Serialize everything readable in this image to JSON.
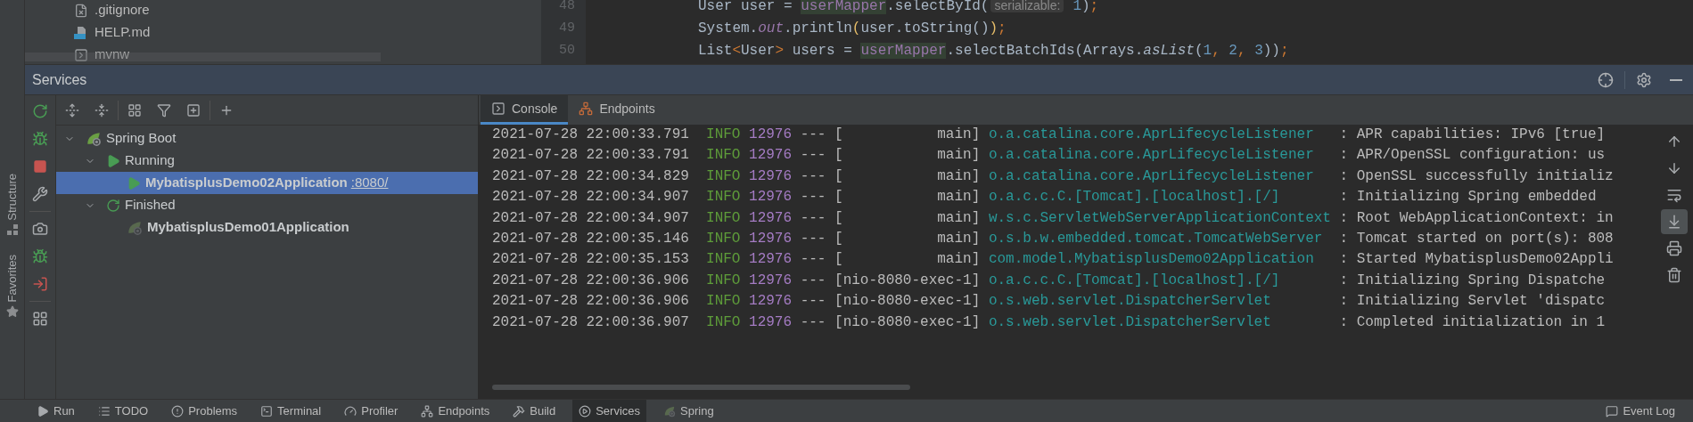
{
  "side_tabs": [
    {
      "label": "Structure",
      "kind": "structure"
    },
    {
      "label": "Favorites",
      "kind": "favorites"
    }
  ],
  "project_tree": {
    "items": [
      {
        "label": ".gitignore",
        "kind": "ignore"
      },
      {
        "label": "HELP.md",
        "kind": "markdown"
      },
      {
        "label": "mvnw",
        "kind": "script"
      }
    ]
  },
  "editor": {
    "lines": [
      {
        "number": "48",
        "segments": [
          {
            "text": "User user = ",
            "kind": "plain"
          },
          {
            "text": "userMapper",
            "kind": "member"
          },
          {
            "text": ".selectById(",
            "kind": "plain"
          },
          {
            "text": "serializable:",
            "kind": "hint"
          },
          {
            "text": "1",
            "kind": "number"
          },
          {
            "text": ")",
            "kind": "plain"
          },
          {
            "text": ";",
            "kind": "keyword"
          }
        ]
      },
      {
        "number": "49",
        "segments": [
          {
            "text": "System.",
            "kind": "plain"
          },
          {
            "text": "out",
            "kind": "static_field"
          },
          {
            "text": ".println",
            "kind": "plain"
          },
          {
            "text": "(",
            "kind": "brace"
          },
          {
            "text": "user.toString()",
            "kind": "plain"
          },
          {
            "text": ")",
            "kind": "brace"
          },
          {
            "text": ";",
            "kind": "keyword"
          }
        ]
      },
      {
        "number": "50",
        "segments": [
          {
            "text": "List",
            "kind": "plain"
          },
          {
            "text": "<",
            "kind": "keyword"
          },
          {
            "text": "User",
            "kind": "plain"
          },
          {
            "text": ">",
            "kind": "keyword"
          },
          {
            "text": " users = ",
            "kind": "plain"
          },
          {
            "text": "userMapper",
            "kind": "member"
          },
          {
            "text": ".selectBatchIds(Arrays.",
            "kind": "plain"
          },
          {
            "text": "asList",
            "kind": "static_method"
          },
          {
            "text": "(",
            "kind": "plain"
          },
          {
            "text": "1",
            "kind": "number"
          },
          {
            "text": ", ",
            "kind": "keyword"
          },
          {
            "text": "2",
            "kind": "number"
          },
          {
            "text": ", ",
            "kind": "keyword"
          },
          {
            "text": "3",
            "kind": "number"
          },
          {
            "text": "))",
            "kind": "plain"
          },
          {
            "text": ";",
            "kind": "keyword"
          }
        ]
      }
    ]
  },
  "services_panel": {
    "title": "Services",
    "tree": [
      {
        "label": "Spring Boot",
        "kind": "spring",
        "expanded": true,
        "selected": false,
        "children": [
          {
            "label": "Running",
            "kind": "running",
            "expanded": true,
            "selected": false,
            "children": [
              {
                "label": "MybatisplusDemo02Application",
                "link": ":8080/",
                "kind": "running_app",
                "selected": true
              }
            ]
          },
          {
            "label": "Finished",
            "kind": "finished",
            "expanded": true,
            "selected": false,
            "children": [
              {
                "label": "MybatisplusDemo01Application",
                "kind": "finished_app",
                "selected": false
              }
            ]
          }
        ]
      }
    ]
  },
  "console": {
    "tabs": [
      {
        "label": "Console",
        "kind": "console",
        "selected": true
      },
      {
        "label": "Endpoints",
        "kind": "endpoints",
        "selected": false
      }
    ],
    "scroll_to_end": true,
    "lines": [
      {
        "timestamp": "2021-07-28 22:00:33.791",
        "level": "INFO",
        "pid": "12976",
        "dashes": "---",
        "thread": "[           main]",
        "logger": "o.a.catalina.core.AprLifecycleListener",
        "message": ": APR capabilities: IPv6 [true]"
      },
      {
        "timestamp": "2021-07-28 22:00:33.791",
        "level": "INFO",
        "pid": "12976",
        "dashes": "---",
        "thread": "[           main]",
        "logger": "o.a.catalina.core.AprLifecycleListener",
        "message": ": APR/OpenSSL configuration: us"
      },
      {
        "timestamp": "2021-07-28 22:00:34.829",
        "level": "INFO",
        "pid": "12976",
        "dashes": "---",
        "thread": "[           main]",
        "logger": "o.a.catalina.core.AprLifecycleListener",
        "message": ": OpenSSL successfully initializ"
      },
      {
        "timestamp": "2021-07-28 22:00:34.907",
        "level": "INFO",
        "pid": "12976",
        "dashes": "---",
        "thread": "[           main]",
        "logger": "o.a.c.c.C.[Tomcat].[localhost].[/]",
        "message": ": Initializing Spring embedded"
      },
      {
        "timestamp": "2021-07-28 22:00:34.907",
        "level": "INFO",
        "pid": "12976",
        "dashes": "---",
        "thread": "[           main]",
        "logger": "w.s.c.ServletWebServerApplicationContext",
        "message": ": Root WebApplicationContext: in"
      },
      {
        "timestamp": "2021-07-28 22:00:35.146",
        "level": "INFO",
        "pid": "12976",
        "dashes": "---",
        "thread": "[           main]",
        "logger": "o.s.b.w.embedded.tomcat.TomcatWebServer",
        "message": ": Tomcat started on port(s): 808"
      },
      {
        "timestamp": "2021-07-28 22:00:35.153",
        "level": "INFO",
        "pid": "12976",
        "dashes": "---",
        "thread": "[           main]",
        "logger": "com.model.MybatisplusDemo02Application",
        "message": ": Started MybatisplusDemo02Appli"
      },
      {
        "timestamp": "2021-07-28 22:00:36.906",
        "level": "INFO",
        "pid": "12976",
        "dashes": "---",
        "thread": "[nio-8080-exec-1]",
        "logger": "o.a.c.c.C.[Tomcat].[localhost].[/]",
        "message": ": Initializing Spring Dispatche"
      },
      {
        "timestamp": "2021-07-28 22:00:36.906",
        "level": "INFO",
        "pid": "12976",
        "dashes": "---",
        "thread": "[nio-8080-exec-1]",
        "logger": "o.s.web.servlet.DispatcherServlet",
        "message": ": Initializing Servlet 'dispatc"
      },
      {
        "timestamp": "2021-07-28 22:00:36.907",
        "level": "INFO",
        "pid": "12976",
        "dashes": "---",
        "thread": "[nio-8080-exec-1]",
        "logger": "o.s.web.servlet.DispatcherServlet",
        "message": ": Completed initialization in 1"
      }
    ]
  },
  "bottom_bar": {
    "tabs": [
      {
        "label": "Run",
        "kind": "run",
        "selected": false
      },
      {
        "label": "TODO",
        "kind": "todo",
        "selected": false
      },
      {
        "label": "Problems",
        "kind": "problems",
        "selected": false
      },
      {
        "label": "Terminal",
        "kind": "terminal",
        "selected": false
      },
      {
        "label": "Profiler",
        "kind": "profiler",
        "selected": false
      },
      {
        "label": "Endpoints",
        "kind": "endpoints",
        "selected": false
      },
      {
        "label": "Build",
        "kind": "build",
        "selected": false
      },
      {
        "label": "Services",
        "kind": "services",
        "selected": true
      },
      {
        "label": "Spring",
        "kind": "spring",
        "selected": false
      }
    ],
    "event_log": "Event Log"
  }
}
